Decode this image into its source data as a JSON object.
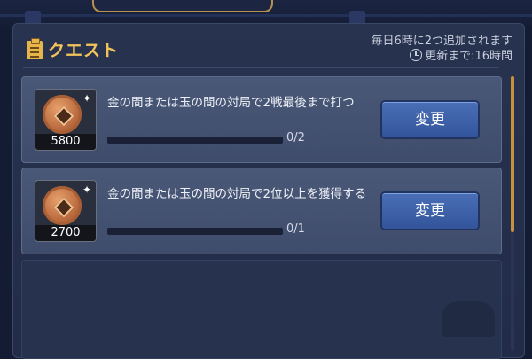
{
  "header": {
    "title": "クエスト",
    "info_line1": "毎日6時に2つ追加されます",
    "info_line2": "更新まで:16時間"
  },
  "quests": [
    {
      "reward_amount": "5800",
      "text": "金の間または玉の間の対局で2戦最後まで打つ",
      "progress_text": "0/2",
      "progress_fraction": 0,
      "button_label": "変更"
    },
    {
      "reward_amount": "2700",
      "text": "金の間または玉の間の対局で2位以上を獲得する",
      "progress_text": "0/1",
      "progress_fraction": 0,
      "button_label": "変更"
    }
  ],
  "icons": {
    "title": "clipboard-icon",
    "timer": "clock-icon",
    "reward": "coin-icon"
  },
  "colors": {
    "accent_gold": "#f2c45a",
    "button_blue": "#3f62aa",
    "panel_bg": "#27334f"
  }
}
